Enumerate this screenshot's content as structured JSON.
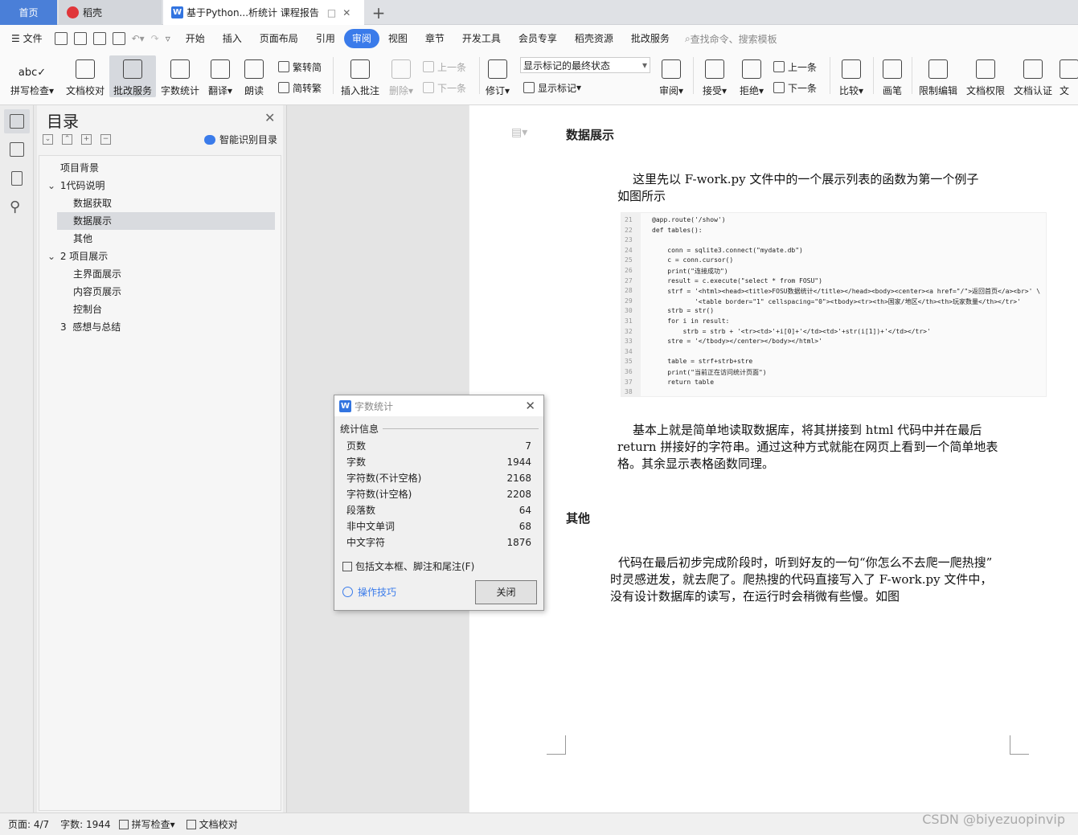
{
  "tabs": {
    "home": "首页",
    "daoke": "稻壳",
    "doc": "基于Python...析统计 课程报告"
  },
  "menubar": {
    "file": "文件",
    "items": [
      "开始",
      "插入",
      "页面布局",
      "引用",
      "审阅",
      "视图",
      "章节",
      "开发工具",
      "会员专享",
      "稻壳资源",
      "批改服务"
    ],
    "active": "审阅",
    "search": "查找命令、搜索模板"
  },
  "ribbon": {
    "spell": "拼写检查",
    "proof": "文档校对",
    "correct": "批改服务",
    "wordcount": "字数统计",
    "translate": "翻译",
    "read": "朗读",
    "trad": "繁转简",
    "simp": "简转繁",
    "insert_comment": "插入批注",
    "delete": "删除",
    "prev": "上一条",
    "next": "下一条",
    "revise": "修订",
    "markup_state": "显示标记的最终状态",
    "show_markup": "显示标记",
    "review": "审阅",
    "accept": "接受",
    "reject": "拒绝",
    "prev2": "上一条",
    "next2": "下一条",
    "compare": "比较",
    "pen": "画笔",
    "restrict": "限制编辑",
    "perm": "文档权限",
    "cert": "文档认证",
    "more": "文"
  },
  "toc": {
    "title": "目录",
    "smart": "智能识别目录",
    "items": [
      "项目背景",
      "1代码说明",
      "数据获取",
      "数据展示",
      "其他",
      "2 项目展示",
      "主界面展示",
      "内容页展示",
      "控制台",
      "3  感想与总结"
    ]
  },
  "doc": {
    "h1": "数据展示",
    "p1a": "这里先以 F-work.py 文件中的一个展示列表的函数为第一个例子",
    "p1b": "如图所示",
    "p2a": "基本上就是简单地读取数据库，将其拼接到 html 代码中并在最后",
    "p2b": "return 拼接好的字符串。通过这种方式就能在网页上看到一个简单地表",
    "p2c": "格。其余显示表格函数同理。",
    "h2": "其他",
    "p3a": "代码在最后初步完成阶段时，听到好友的一句“你怎么不去爬一爬热搜”",
    "p3b": "时灵感迸发，就去爬了。爬热搜的代码直接写入了 F-work.py 文件中，",
    "p3c": "没有设计数据库的读写，在运行时会稍微有些慢。如图"
  },
  "code": {
    "lines": [
      {
        "n": "21",
        "t": "@app.route('/show')"
      },
      {
        "n": "22",
        "t": "def tables():"
      },
      {
        "n": "23",
        "t": ""
      },
      {
        "n": "24",
        "t": "    conn = sqlite3.connect(\"mydate.db\")"
      },
      {
        "n": "25",
        "t": "    c = conn.cursor()"
      },
      {
        "n": "26",
        "t": "    print(\"连接成功\")"
      },
      {
        "n": "27",
        "t": "    result = c.execute(\"select * from FOSU\")"
      },
      {
        "n": "28",
        "t": "    strf = '<html><head><title>FOSU数据统计</title></head><body><center><a href=\"/\">返回首页</a><br>' \\"
      },
      {
        "n": "29",
        "t": "           '<table border=\"1\" cellspacing=\"0\"><tbody><tr><th>国家/地区</th><th>玩家数量</th></tr>'"
      },
      {
        "n": "30",
        "t": "    strb = str()"
      },
      {
        "n": "31",
        "t": "    for i in result:"
      },
      {
        "n": "32",
        "t": "        strb = strb + '<tr><td>'+i[0]+'</td><td>'+str(i[1])+'</td></tr>'"
      },
      {
        "n": "33",
        "t": "    stre = '</tbody></center></body></html>'"
      },
      {
        "n": "34",
        "t": ""
      },
      {
        "n": "35",
        "t": "    table = strf+strb+stre"
      },
      {
        "n": "36",
        "t": "    print(\"当前正在访问统计页面\")"
      },
      {
        "n": "37",
        "t": "    return table"
      },
      {
        "n": "38",
        "t": ""
      }
    ]
  },
  "dialog": {
    "title": "字数统计",
    "section": "统计信息",
    "rows": [
      {
        "label": "页数",
        "value": "7"
      },
      {
        "label": "字数",
        "value": "1944"
      },
      {
        "label": "字符数(不计空格)",
        "value": "2168"
      },
      {
        "label": "字符数(计空格)",
        "value": "2208"
      },
      {
        "label": "段落数",
        "value": "64"
      },
      {
        "label": "非中文单词",
        "value": "68"
      },
      {
        "label": "中文字符",
        "value": "1876"
      }
    ],
    "checkbox": "包括文本框、脚注和尾注(F)",
    "tips": "操作技巧",
    "close": "关闭"
  },
  "status": {
    "page": "页面: 4/7",
    "words": "字数: 1944",
    "spell": "拼写检查",
    "proof": "文档校对"
  },
  "watermark": "CSDN @biyezuopinvip"
}
